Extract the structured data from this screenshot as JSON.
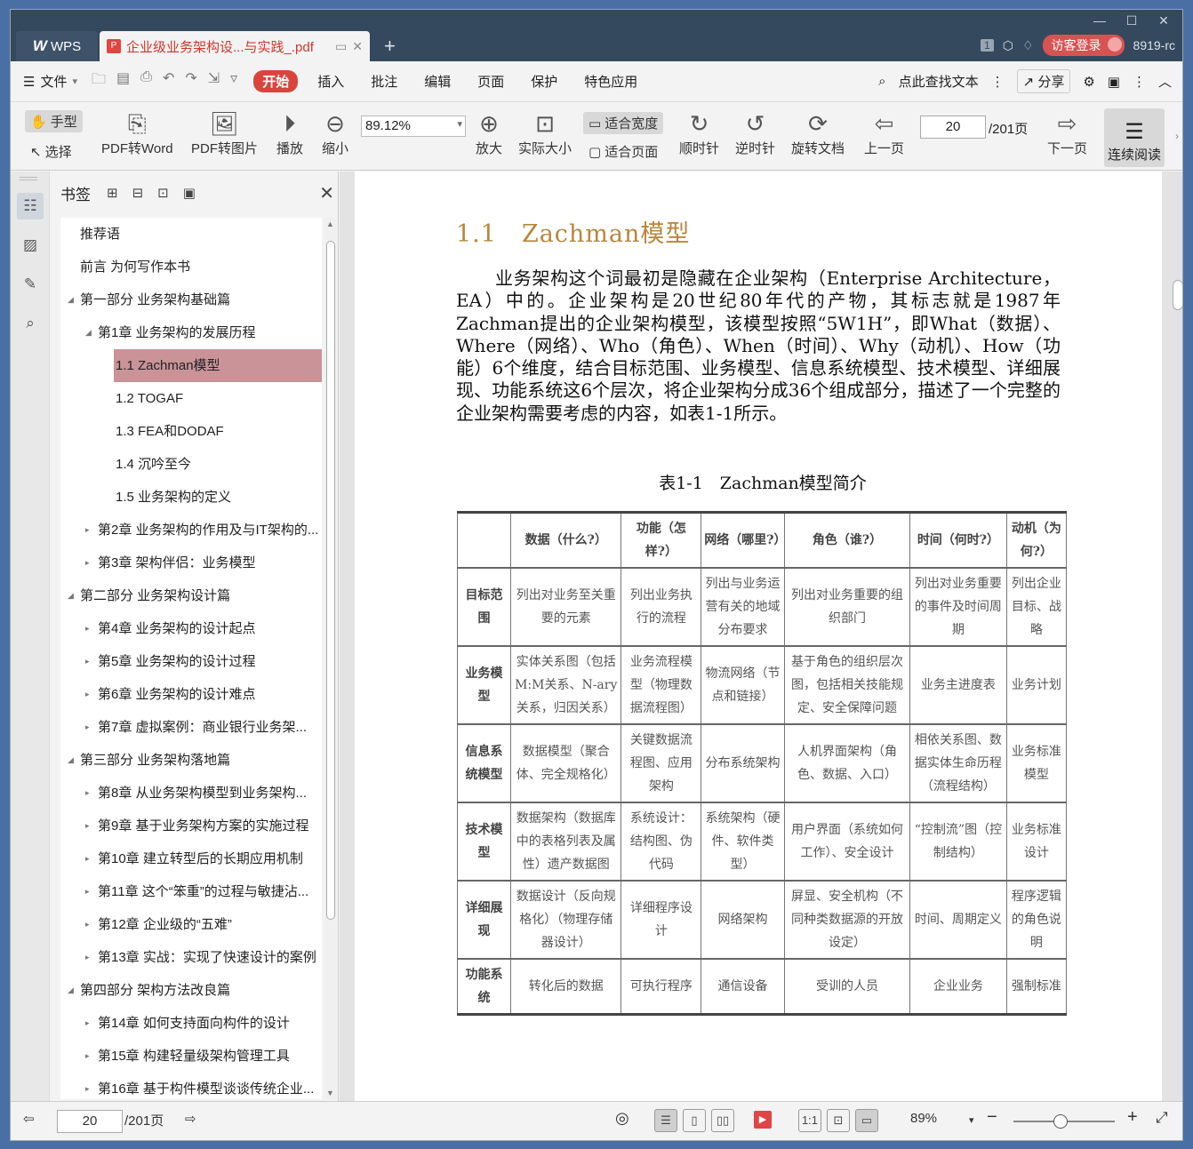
{
  "window": {
    "wps_label": "WPS",
    "doc_tab_title": "企业级业务架构设...与实践_.pdf",
    "add_tab": "+",
    "page_count_badge": "1",
    "login_label": "访客登录",
    "version": "8919-rc",
    "controls": [
      "—",
      "☐",
      "✕"
    ]
  },
  "menu": {
    "file": "文件",
    "tabs": [
      "开始",
      "插入",
      "批注",
      "编辑",
      "页面",
      "保护",
      "特色应用"
    ],
    "active_tab": "开始",
    "search": "点此查找文本",
    "share": "分享"
  },
  "toolbar": {
    "hand": "手型",
    "select": "选择",
    "pdf_to_word": "PDF转Word",
    "pdf_to_image": "PDF转图片",
    "play": "播放",
    "zoom_out": "缩小",
    "zoom_value": "89.12%",
    "zoom_in": "放大",
    "actual_size": "实际大小",
    "fit_width": "适合宽度",
    "fit_page": "适合页面",
    "rotate_cw": "顺时针",
    "rotate_ccw": "逆时针",
    "rotate_doc": "旋转文档",
    "prev_page": "上一页",
    "current_page": "20",
    "total_pages": "/201页",
    "next_page": "下一页",
    "continuous": "连续阅读"
  },
  "bookmarks": {
    "title": "书签",
    "items": [
      {
        "label": "推荐语",
        "level": 0,
        "arrow": ""
      },
      {
        "label": "前言 为何写作本书",
        "level": 0,
        "arrow": ""
      },
      {
        "label": "第一部分 业务架构基础篇",
        "level": 0,
        "arrow": "◢"
      },
      {
        "label": "第1章 业务架构的发展历程",
        "level": 1,
        "arrow": "◢"
      },
      {
        "label": "1.1 Zachman模型",
        "level": 2,
        "arrow": "",
        "selected": true
      },
      {
        "label": "1.2 TOGAF",
        "level": 2,
        "arrow": ""
      },
      {
        "label": "1.3 FEA和DODAF",
        "level": 2,
        "arrow": ""
      },
      {
        "label": "1.4 沉吟至今",
        "level": 2,
        "arrow": ""
      },
      {
        "label": "1.5 业务架构的定义",
        "level": 2,
        "arrow": ""
      },
      {
        "label": "第2章 业务架构的作用及与IT架构的...",
        "level": 1,
        "arrow": "▸"
      },
      {
        "label": "第3章 架构伴侣：业务模型",
        "level": 1,
        "arrow": "▸"
      },
      {
        "label": "第二部分 业务架构设计篇",
        "level": 0,
        "arrow": "◢"
      },
      {
        "label": "第4章 业务架构的设计起点",
        "level": 1,
        "arrow": "▸"
      },
      {
        "label": "第5章 业务架构的设计过程",
        "level": 1,
        "arrow": "▸"
      },
      {
        "label": "第6章 业务架构的设计难点",
        "level": 1,
        "arrow": "▸"
      },
      {
        "label": "第7章 虚拟案例：商业银行业务架...",
        "level": 1,
        "arrow": "▸"
      },
      {
        "label": "第三部分 业务架构落地篇",
        "level": 0,
        "arrow": "◢"
      },
      {
        "label": "第8章 从业务架构模型到业务架构...",
        "level": 1,
        "arrow": "▸"
      },
      {
        "label": "第9章 基于业务架构方案的实施过程",
        "level": 1,
        "arrow": "▸"
      },
      {
        "label": "第10章 建立转型后的长期应用机制",
        "level": 1,
        "arrow": "▸"
      },
      {
        "label": "第11章 这个“笨重”的过程与敏捷沾...",
        "level": 1,
        "arrow": "▸"
      },
      {
        "label": "第12章 企业级的“五难”",
        "level": 1,
        "arrow": "▸"
      },
      {
        "label": "第13章 实战：实现了快速设计的案例",
        "level": 1,
        "arrow": "▸"
      },
      {
        "label": "第四部分 架构方法改良篇",
        "level": 0,
        "arrow": "◢"
      },
      {
        "label": "第14章 如何支持面向构件的设计",
        "level": 1,
        "arrow": "▸"
      },
      {
        "label": "第15章 构建轻量级架构管理工具",
        "level": 1,
        "arrow": "▸"
      },
      {
        "label": "第16章 基于构件模型谈谈传统企业...",
        "level": 1,
        "arrow": "▸"
      }
    ]
  },
  "document": {
    "heading": "1.1　Zachman模型",
    "paragraph": "业务架构这个词最初是隐藏在企业架构（Enterprise Architecture，EA）中的。企业架构是20世纪80年代的产物，其标志就是1987年Zachman提出的企业架构模型，该模型按照“5W1H”，即What（数据）、Where（网络）、Who（角色）、When（时间）、Why（动机）、How（功能）6个维度，结合目标范围、业务模型、信息系统模型、技术模型、详细展现、功能系统这6个层次，将企业架构分成36个组成部分，描述了一个完整的企业架构需要考虑的内容，如表1-1所示。",
    "table_caption": "表1-1　Zachman模型简介",
    "table": {
      "headers": [
        "",
        "数据（什么?）",
        "功能（怎样?）",
        "网络（哪里?）",
        "角色（谁?）",
        "时间（何时?）",
        "动机（为何?）"
      ],
      "rows": [
        [
          "目标范围",
          "列出对业务至关重要的元素",
          "列出业务执行的流程",
          "列出与业务运营有关的地域分布要求",
          "列出对业务重要的组织部门",
          "列出对业务重要的事件及时间周期",
          "列出企业目标、战略"
        ],
        [
          "业务模型",
          "实体关系图（包括M:M关系、N-ary关系，归因关系）",
          "业务流程模型（物理数据流程图）",
          "物流网络（节点和链接）",
          "基于角色的组织层次图，包括相关技能规定、安全保障问题",
          "业务主进度表",
          "业务计划"
        ],
        [
          "信息系统模型",
          "数据模型（聚合体、完全规格化）",
          "关键数据流程图、应用架构",
          "分布系统架构",
          "人机界面架构（角色、数据、入口）",
          "相依关系图、数据实体生命历程（流程结构）",
          "业务标准模型"
        ],
        [
          "技术模型",
          "数据架构（数据库中的表格列表及属性）遗产数据图",
          "系统设计：结构图、伪代码",
          "系统架构（硬件、软件类型）",
          "用户界面（系统如何工作）、安全设计",
          "“控制流”图（控制结构）",
          "业务标准设计"
        ],
        [
          "详细展现",
          "数据设计（反向规格化）（物理存储器设计）",
          "详细程序设计",
          "网络架构",
          "屏显、安全机构（不同种类数据源的开放设定）",
          "时间、周期定义",
          "程序逻辑的角色说明"
        ],
        [
          "功能系统",
          "转化后的数据",
          "可执行程序",
          "通信设备",
          "受训的人员",
          "企业业务",
          "强制标准"
        ]
      ]
    }
  },
  "statusbar": {
    "current_page": "20",
    "total_pages": "/201页",
    "zoom": "89%",
    "zoom_level_percent": 89
  }
}
